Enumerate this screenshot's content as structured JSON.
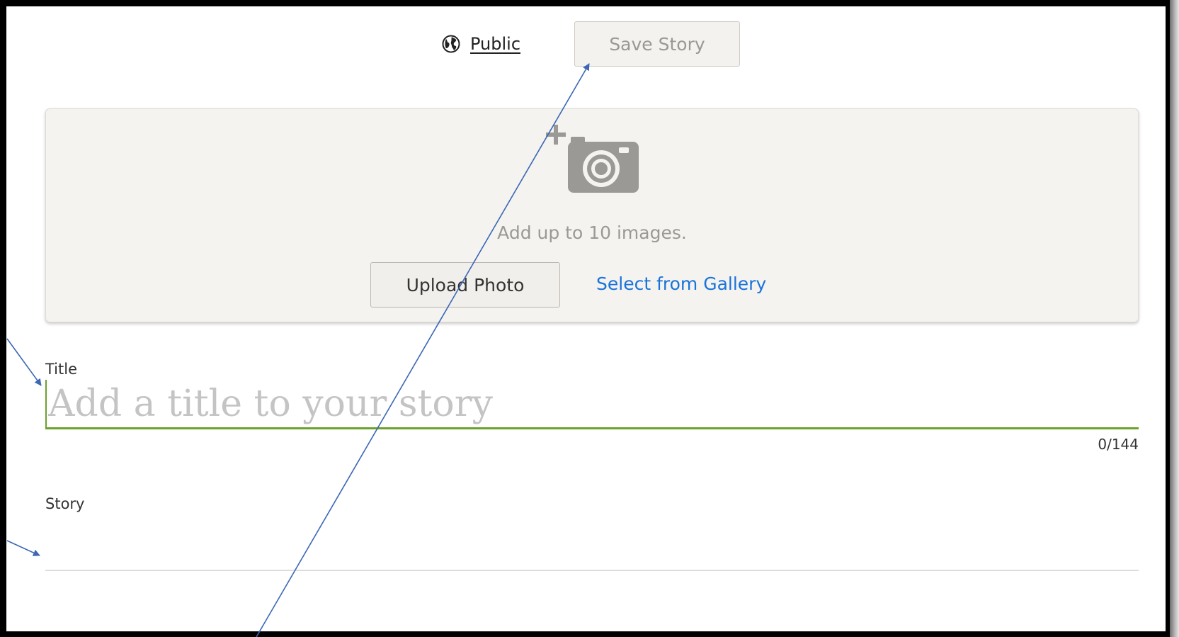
{
  "header": {
    "visibility_label": "Public",
    "save_label": "Save Story"
  },
  "upload": {
    "hint": "Add up to 10 images.",
    "upload_label": "Upload Photo",
    "gallery_label": "Select from Gallery"
  },
  "title_field": {
    "label": "Title",
    "placeholder": "Add a title to your story",
    "counter": "0/144"
  },
  "story_field": {
    "label": "Story"
  },
  "colors": {
    "accent_green": "#6aa22b",
    "link_blue": "#1a73d9",
    "annotation_blue": "#3b67b5"
  },
  "icons": [
    "globe-icon",
    "camera-add-icon"
  ]
}
